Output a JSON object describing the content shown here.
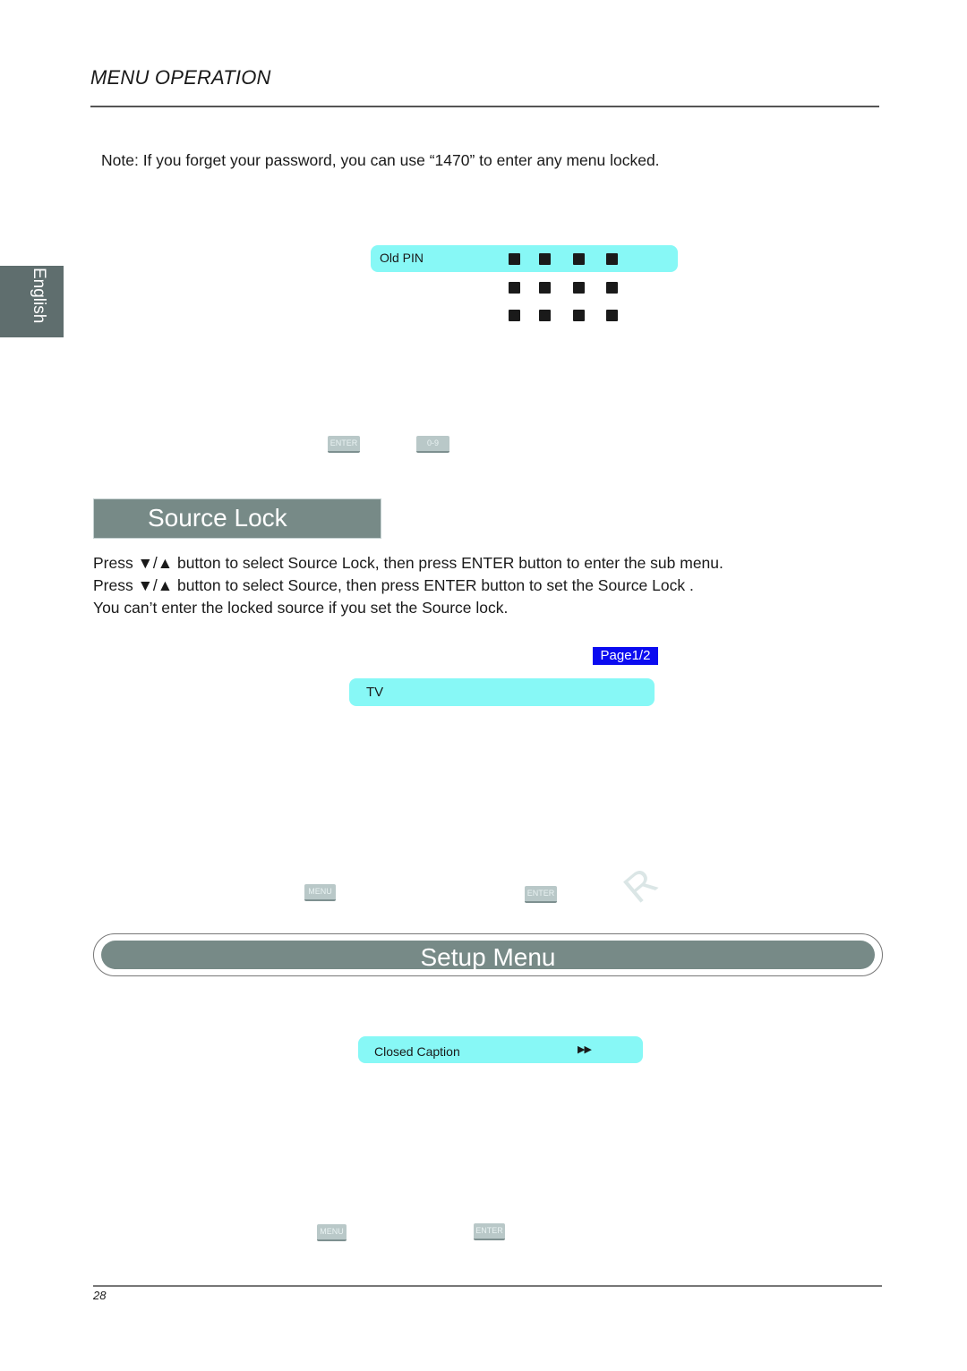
{
  "header": {
    "title": "MENU OPERATION"
  },
  "note": "Note: If you forget your password, you can use “1470” to enter any menu locked.",
  "language_tab": "English",
  "pin_menu": {
    "selected_row_label": "Old PIN",
    "rows": 3,
    "digits_per_row": 4
  },
  "pin_keys": {
    "enter": "ENTER",
    "digits": "0-9"
  },
  "source_lock": {
    "title": "Source Lock",
    "lines": [
      "Press ▼/▲ button to select Source Lock, then press ENTER button to enter the sub menu.",
      "Press ▼/▲ button to select Source, then press ENTER button to set the Source Lock .",
      "You can’t enter the locked source if you set the Source lock."
    ],
    "page_badge": "Page1/2",
    "selected_source": "TV",
    "keys": {
      "menu": "MENU",
      "enter": "ENTER"
    }
  },
  "watermark": "R",
  "setup_menu": {
    "title": "Setup Menu",
    "selected_item": "Closed Caption",
    "selected_item_arrow": "▶▶",
    "keys": {
      "menu": "MENU",
      "enter": "ENTER"
    }
  },
  "footer": {
    "page_number": "28"
  },
  "colors": {
    "highlight": "#87f8f6",
    "section_bar": "#778a87",
    "page_badge": "#0b0bf0"
  }
}
